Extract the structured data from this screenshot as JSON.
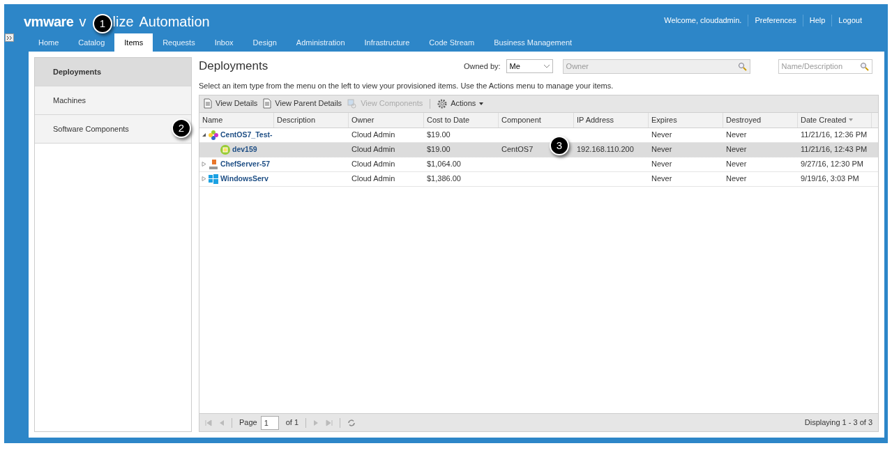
{
  "header": {
    "brand": "vmware",
    "product_start": "v",
    "product_end": "lize",
    "product_rest": "Automation",
    "user_links": [
      "Welcome, cloudadmin.",
      "Preferences",
      "Help",
      "Logout"
    ]
  },
  "nav_tabs": [
    {
      "label": "Home",
      "selected": false
    },
    {
      "label": "Catalog",
      "selected": false
    },
    {
      "label": "Items",
      "selected": true
    },
    {
      "label": "Requests",
      "selected": false
    },
    {
      "label": "Inbox",
      "selected": false
    },
    {
      "label": "Design",
      "selected": false
    },
    {
      "label": "Administration",
      "selected": false
    },
    {
      "label": "Infrastructure",
      "selected": false
    },
    {
      "label": "Code Stream",
      "selected": false
    },
    {
      "label": "Business Management",
      "selected": false
    }
  ],
  "sidebar": {
    "items": [
      {
        "label": "Deployments",
        "selected": true
      },
      {
        "label": "Machines",
        "selected": false
      },
      {
        "label": "Software Components",
        "selected": false
      }
    ]
  },
  "content": {
    "title": "Deployments",
    "owned_by_label": "Owned by:",
    "owned_by_value": "Me",
    "owner_placeholder": "Owner",
    "name_placeholder": "Name/Description",
    "hint": "Select an item type from the menu on the left to view your provisioned items. Use the Actions menu to manage your items."
  },
  "toolbar": [
    {
      "label": "View Details",
      "disabled": false,
      "kind": "doc"
    },
    {
      "label": "View Parent Details",
      "disabled": false,
      "kind": "doc"
    },
    {
      "label": "View Components",
      "disabled": true,
      "kind": "components"
    },
    {
      "label": "Actions",
      "disabled": false,
      "kind": "gear"
    }
  ],
  "table": {
    "name_column": "Name",
    "columns": [
      "Description",
      "Owner",
      "Cost to Date",
      "Component",
      "IP Address",
      "Expires",
      "Destroyed",
      "Date Created"
    ],
    "rows": [
      {
        "kind": "centos",
        "name": "CentOS7_Test-",
        "expanded": true,
        "selected": false,
        "cells": [
          "",
          "Cloud Admin",
          "$19.00",
          "",
          "",
          "Never",
          "Never",
          "11/21/16, 12:36 PM"
        ],
        "children": [
          {
            "kind": "machine",
            "name": "dev159",
            "selected": true,
            "cells": [
              "",
              "Cloud Admin",
              "$19.00",
              "CentOS7",
              "192.168.110.200",
              "Never",
              "Never",
              "11/21/16, 12:43 PM"
            ]
          }
        ]
      },
      {
        "kind": "chef",
        "name": "ChefServer-57",
        "expanded": false,
        "selected": false,
        "cells": [
          "",
          "Cloud Admin",
          "$1,064.00",
          "",
          "",
          "Never",
          "Never",
          "9/27/16, 12:30 PM"
        ]
      },
      {
        "kind": "windows",
        "name": "WindowsServ",
        "expanded": false,
        "selected": false,
        "cells": [
          "",
          "Cloud Admin",
          "$1,386.00",
          "",
          "",
          "Never",
          "Never",
          "9/19/16, 3:03 PM"
        ]
      }
    ]
  },
  "pager": {
    "page_label": "Page",
    "page_value": "1",
    "of_label": "of 1",
    "status": "Displaying 1 - 3 of 3"
  },
  "callouts": [
    "1",
    "2",
    "3"
  ]
}
